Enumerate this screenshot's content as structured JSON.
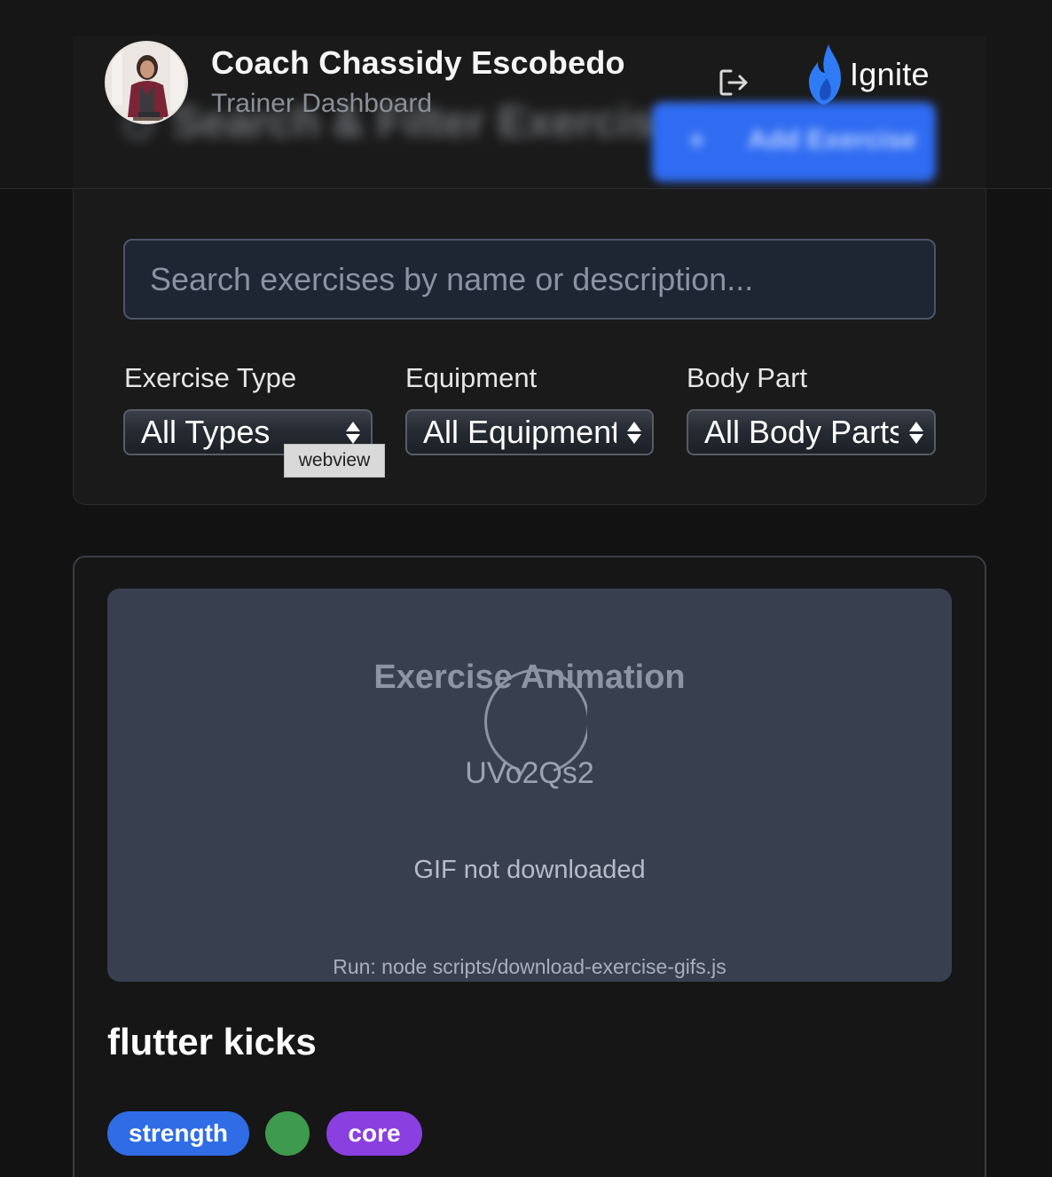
{
  "header": {
    "coach_name": "Coach Chassidy Escobedo",
    "subtitle": "Trainer Dashboard",
    "blurred_title": "Search & Filter Exercises",
    "blurred_button": "Add Exercise",
    "brand_name": "Ignite",
    "brand_color": "#2f7bf5",
    "logout_icon": "logout-icon"
  },
  "filters": {
    "search_placeholder": "Search exercises by name or description...",
    "exercise_type": {
      "label": "Exercise Type",
      "selected": "All Types"
    },
    "equipment": {
      "label": "Equipment",
      "selected": "All Equipment"
    },
    "body_part": {
      "label": "Body Part",
      "selected": "All Body Parts"
    },
    "tooltip": "webview"
  },
  "exercise": {
    "animation_title": "Exercise Animation",
    "animation_id": "UVo2Qs2",
    "status": "GIF not downloaded",
    "hint": "Run: node scripts/download-exercise-gifs.js",
    "name": "flutter kicks",
    "tags": [
      {
        "label": "strength",
        "color": "#2f6ce5"
      },
      {
        "label": "",
        "color": "#3e9a4c"
      },
      {
        "label": "core",
        "color": "#8a3fe0"
      }
    ]
  }
}
